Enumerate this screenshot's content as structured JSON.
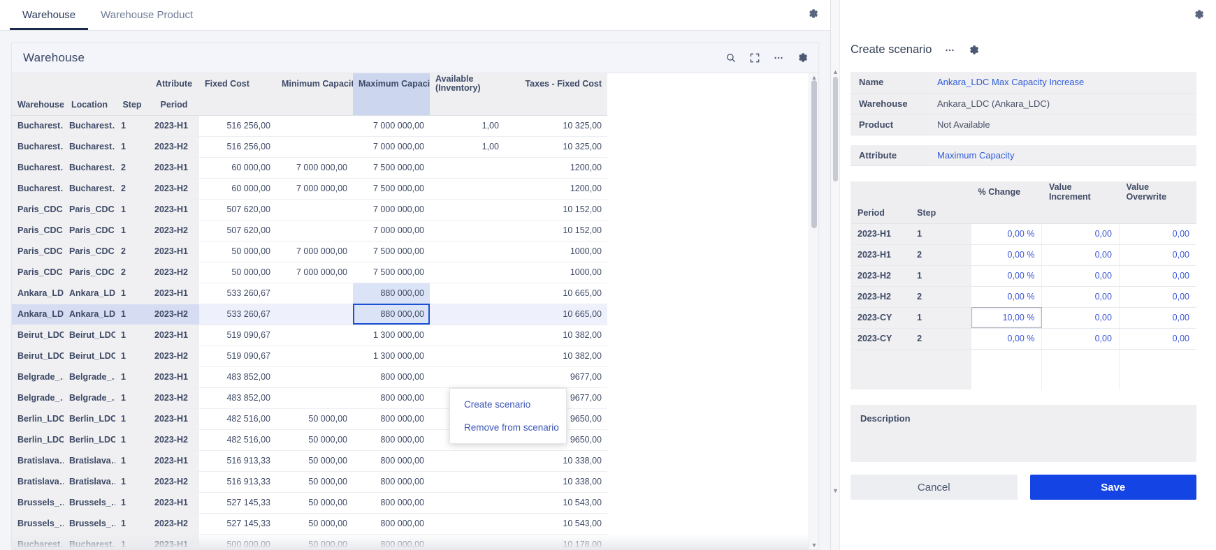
{
  "tabs": [
    {
      "label": "Warehouse",
      "active": true
    },
    {
      "label": "Warehouse Product",
      "active": false
    }
  ],
  "card": {
    "title": "Warehouse",
    "icons": [
      "search-icon",
      "fullscreen-icon",
      "more-icon",
      "gear-icon"
    ]
  },
  "grid": {
    "group_headers": [
      "",
      "",
      "",
      "Attribute",
      "Fixed Cost",
      "Minimum Capacity",
      "Maximum Capacity",
      "Available (Inventory)",
      "Taxes - Fixed Cost"
    ],
    "sub_headers": [
      "Warehouse",
      "Location",
      "Step",
      "Period",
      "",
      "",
      "",
      "",
      ""
    ],
    "rows": [
      {
        "warehouse": "Bucharest…",
        "location": "Bucharest…",
        "step": "1",
        "period": "2023-H1",
        "fixed_cost": "516 256,00",
        "min_capacity": "",
        "max_capacity": "7 000 000,00",
        "available": "1,00",
        "taxes_fixed_cost": "10 325,00"
      },
      {
        "warehouse": "Bucharest…",
        "location": "Bucharest…",
        "step": "1",
        "period": "2023-H2",
        "fixed_cost": "516 256,00",
        "min_capacity": "",
        "max_capacity": "7 000 000,00",
        "available": "1,00",
        "taxes_fixed_cost": "10 325,00"
      },
      {
        "warehouse": "Bucharest…",
        "location": "Bucharest…",
        "step": "2",
        "period": "2023-H1",
        "fixed_cost": "60 000,00",
        "min_capacity": "7 000 000,00",
        "max_capacity": "7 500 000,00",
        "available": "",
        "taxes_fixed_cost": "1200,00"
      },
      {
        "warehouse": "Bucharest…",
        "location": "Bucharest…",
        "step": "2",
        "period": "2023-H2",
        "fixed_cost": "60 000,00",
        "min_capacity": "7 000 000,00",
        "max_capacity": "7 500 000,00",
        "available": "",
        "taxes_fixed_cost": "1200,00"
      },
      {
        "warehouse": "Paris_CDC",
        "location": "Paris_CDC",
        "step": "1",
        "period": "2023-H1",
        "fixed_cost": "507 620,00",
        "min_capacity": "",
        "max_capacity": "7 000 000,00",
        "available": "",
        "taxes_fixed_cost": "10 152,00"
      },
      {
        "warehouse": "Paris_CDC",
        "location": "Paris_CDC",
        "step": "1",
        "period": "2023-H2",
        "fixed_cost": "507 620,00",
        "min_capacity": "",
        "max_capacity": "7 000 000,00",
        "available": "",
        "taxes_fixed_cost": "10 152,00"
      },
      {
        "warehouse": "Paris_CDC",
        "location": "Paris_CDC",
        "step": "2",
        "period": "2023-H1",
        "fixed_cost": "50 000,00",
        "min_capacity": "7 000 000,00",
        "max_capacity": "7 500 000,00",
        "available": "",
        "taxes_fixed_cost": "1000,00"
      },
      {
        "warehouse": "Paris_CDC",
        "location": "Paris_CDC",
        "step": "2",
        "period": "2023-H2",
        "fixed_cost": "50 000,00",
        "min_capacity": "7 000 000,00",
        "max_capacity": "7 500 000,00",
        "available": "",
        "taxes_fixed_cost": "1000,00"
      },
      {
        "warehouse": "Ankara_LDC",
        "location": "Ankara_LDC",
        "step": "1",
        "period": "2023-H1",
        "fixed_cost": "533 260,67",
        "min_capacity": "",
        "max_capacity": "880 000,00",
        "available": "",
        "taxes_fixed_cost": "10 665,00",
        "max_highlight": true
      },
      {
        "warehouse": "Ankara_LDC",
        "location": "Ankara_LDC",
        "step": "1",
        "period": "2023-H2",
        "fixed_cost": "533 260,67",
        "min_capacity": "",
        "max_capacity": "880 000,00",
        "available": "",
        "taxes_fixed_cost": "10 665,00",
        "selected": true,
        "max_editing": true
      },
      {
        "warehouse": "Beirut_LDC",
        "location": "Beirut_LDC",
        "step": "1",
        "period": "2023-H1",
        "fixed_cost": "519 090,67",
        "min_capacity": "",
        "max_capacity": "1 300 000,00",
        "available": "",
        "taxes_fixed_cost": "10 382,00"
      },
      {
        "warehouse": "Beirut_LDC",
        "location": "Beirut_LDC",
        "step": "1",
        "period": "2023-H2",
        "fixed_cost": "519 090,67",
        "min_capacity": "",
        "max_capacity": "1 300 000,00",
        "available": "",
        "taxes_fixed_cost": "10 382,00"
      },
      {
        "warehouse": "Belgrade_…",
        "location": "Belgrade_…",
        "step": "1",
        "period": "2023-H1",
        "fixed_cost": "483 852,00",
        "min_capacity": "",
        "max_capacity": "800 000,00",
        "available": "",
        "taxes_fixed_cost": "9677,00"
      },
      {
        "warehouse": "Belgrade_…",
        "location": "Belgrade_…",
        "step": "1",
        "period": "2023-H2",
        "fixed_cost": "483 852,00",
        "min_capacity": "",
        "max_capacity": "800 000,00",
        "available": "",
        "taxes_fixed_cost": "9677,00"
      },
      {
        "warehouse": "Berlin_LDC",
        "location": "Berlin_LDC",
        "step": "1",
        "period": "2023-H1",
        "fixed_cost": "482 516,00",
        "min_capacity": "50 000,00",
        "max_capacity": "800 000,00",
        "available": "",
        "taxes_fixed_cost": "9650,00"
      },
      {
        "warehouse": "Berlin_LDC",
        "location": "Berlin_LDC",
        "step": "1",
        "period": "2023-H2",
        "fixed_cost": "482 516,00",
        "min_capacity": "50 000,00",
        "max_capacity": "800 000,00",
        "available": "",
        "taxes_fixed_cost": "9650,00"
      },
      {
        "warehouse": "Bratislava…",
        "location": "Bratislava…",
        "step": "1",
        "period": "2023-H1",
        "fixed_cost": "516 913,33",
        "min_capacity": "50 000,00",
        "max_capacity": "800 000,00",
        "available": "",
        "taxes_fixed_cost": "10 338,00"
      },
      {
        "warehouse": "Bratislava…",
        "location": "Bratislava…",
        "step": "1",
        "period": "2023-H2",
        "fixed_cost": "516 913,33",
        "min_capacity": "50 000,00",
        "max_capacity": "800 000,00",
        "available": "",
        "taxes_fixed_cost": "10 338,00"
      },
      {
        "warehouse": "Brussels_…",
        "location": "Brussels_…",
        "step": "1",
        "period": "2023-H1",
        "fixed_cost": "527 145,33",
        "min_capacity": "50 000,00",
        "max_capacity": "800 000,00",
        "available": "",
        "taxes_fixed_cost": "10 543,00"
      },
      {
        "warehouse": "Brussels_…",
        "location": "Brussels_…",
        "step": "1",
        "period": "2023-H2",
        "fixed_cost": "527 145,33",
        "min_capacity": "50 000,00",
        "max_capacity": "800 000,00",
        "available": "",
        "taxes_fixed_cost": "10 543,00"
      },
      {
        "warehouse": "Bucharest…",
        "location": "Bucharest…",
        "step": "1",
        "period": "2023-H1",
        "fixed_cost": "500 000,00",
        "min_capacity": "50 000,00",
        "max_capacity": "800 000,00",
        "available": "",
        "taxes_fixed_cost": "10 178,00"
      }
    ]
  },
  "context_menu": {
    "items": [
      "Create scenario",
      "Remove from scenario"
    ]
  },
  "panel": {
    "title": "Create scenario",
    "fields": [
      {
        "label": "Name",
        "value": "Ankara_LDC Max Capacity Increase",
        "is_link": true
      },
      {
        "label": "Warehouse",
        "value": "Ankara_LDC (Ankara_LDC)",
        "is_link": false
      },
      {
        "label": "Product",
        "value": "Not Available",
        "is_link": false
      }
    ],
    "attribute": {
      "label": "Attribute",
      "value": "Maximum Capacity",
      "is_link": true
    },
    "scenario_grid": {
      "group_headers": [
        "",
        "",
        "% Change",
        "Value Increment",
        "Value Overwrite"
      ],
      "sub_headers": [
        "Period",
        "Step",
        "",
        "",
        ""
      ],
      "rows": [
        {
          "period": "2023-H1",
          "step": "1",
          "pct_change": "0,00 %",
          "value_increment": "0,00",
          "value_overwrite": "0,00"
        },
        {
          "period": "2023-H1",
          "step": "2",
          "pct_change": "0,00 %",
          "value_increment": "0,00",
          "value_overwrite": "0,00"
        },
        {
          "period": "2023-H2",
          "step": "1",
          "pct_change": "0,00 %",
          "value_increment": "0,00",
          "value_overwrite": "0,00"
        },
        {
          "period": "2023-H2",
          "step": "2",
          "pct_change": "0,00 %",
          "value_increment": "0,00",
          "value_overwrite": "0,00"
        },
        {
          "period": "2023-CY",
          "step": "1",
          "pct_change": "10,00 %",
          "value_increment": "0,00",
          "value_overwrite": "0,00",
          "editing": true
        },
        {
          "period": "2023-CY",
          "step": "2",
          "pct_change": "0,00 %",
          "value_increment": "0,00",
          "value_overwrite": "0,00"
        }
      ]
    },
    "description_label": "Description",
    "description_value": "",
    "cancel_label": "Cancel",
    "save_label": "Save"
  },
  "colors": {
    "accent_blue": "#1544e4",
    "link_blue": "#2f5bd7",
    "selection_blue": "#d6ddf3",
    "header_grey": "#efeff2"
  }
}
